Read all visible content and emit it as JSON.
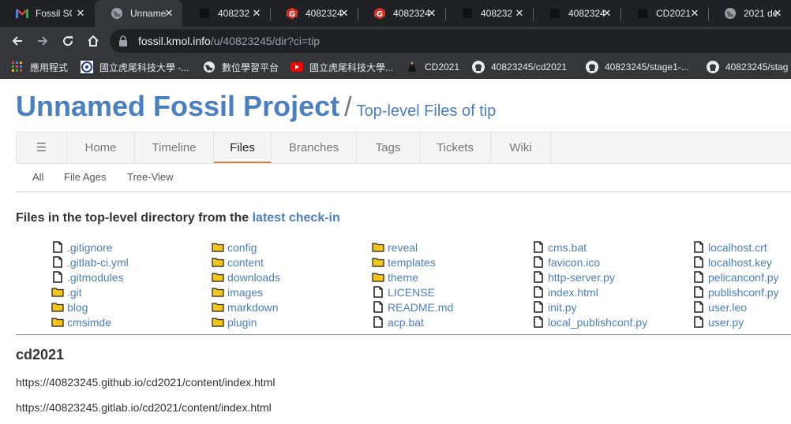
{
  "browser": {
    "tabs": [
      {
        "title": "Fossil SC",
        "icon": "gmail-icon",
        "active": false
      },
      {
        "title": "Unname",
        "icon": "globe-icon",
        "active": true
      },
      {
        "title": "408232",
        "icon": "dark-square-icon",
        "active": false
      },
      {
        "title": "4082324",
        "icon": "red-g-icon",
        "active": false
      },
      {
        "title": "4082324",
        "icon": "red-g-icon",
        "active": false
      },
      {
        "title": "408232",
        "icon": "dark-square-icon",
        "active": false
      },
      {
        "title": "4082324",
        "icon": "dark-square-icon",
        "active": false
      },
      {
        "title": "CD2021",
        "icon": "dark-square-icon",
        "active": false
      },
      {
        "title": "2021 de",
        "icon": "globe-icon",
        "active": false
      }
    ],
    "url_host": "fossil.kmol.info",
    "url_path": "/u/40823245/dir?ci=tip",
    "bookmarks": [
      {
        "label": "應用程式",
        "icon": "apps-grid-icon"
      },
      {
        "label": "國立虎尾科技大學 -...",
        "icon": "school-logo-icon"
      },
      {
        "label": "數位學習平台",
        "icon": "globe-icon"
      },
      {
        "label": "國立虎尾科技大學...",
        "icon": "youtube-icon"
      },
      {
        "label": "CD2021",
        "icon": "dark-logo-icon"
      },
      {
        "label": "40823245/cd2021",
        "icon": "github-icon"
      },
      {
        "label": "40823245/stage1-...",
        "icon": "github-icon"
      },
      {
        "label": "40823245/stag",
        "icon": "github-icon"
      }
    ]
  },
  "header": {
    "project_title": "Unnamed Fossil Project",
    "separator": "/",
    "subtitle": "Top-level Files of tip"
  },
  "mainmenu": {
    "hamburger": "☰",
    "items": [
      "Home",
      "Timeline",
      "Files",
      "Branches",
      "Tags",
      "Tickets",
      "Wiki"
    ],
    "active": "Files"
  },
  "submenu": {
    "items": [
      "All",
      "File Ages",
      "Tree-View"
    ]
  },
  "files": {
    "heading_prefix": "Files in the top-level directory from the ",
    "heading_link": "latest check-in",
    "columns": [
      [
        {
          "name": ".gitignore",
          "type": "file"
        },
        {
          "name": ".gitlab-ci.yml",
          "type": "file"
        },
        {
          "name": ".gitmodules",
          "type": "file"
        },
        {
          "name": ".git",
          "type": "folder"
        },
        {
          "name": "blog",
          "type": "folder"
        },
        {
          "name": "cmsimde",
          "type": "folder"
        }
      ],
      [
        {
          "name": "config",
          "type": "folder"
        },
        {
          "name": "content",
          "type": "folder"
        },
        {
          "name": "downloads",
          "type": "folder"
        },
        {
          "name": "images",
          "type": "folder"
        },
        {
          "name": "markdown",
          "type": "folder"
        },
        {
          "name": "plugin",
          "type": "folder"
        }
      ],
      [
        {
          "name": "reveal",
          "type": "folder"
        },
        {
          "name": "templates",
          "type": "folder"
        },
        {
          "name": "theme",
          "type": "folder"
        },
        {
          "name": "LICENSE",
          "type": "file"
        },
        {
          "name": "README.md",
          "type": "file"
        },
        {
          "name": "acp.bat",
          "type": "file"
        }
      ],
      [
        {
          "name": "cms.bat",
          "type": "file"
        },
        {
          "name": "favicon.ico",
          "type": "file"
        },
        {
          "name": "http-server.py",
          "type": "file"
        },
        {
          "name": "index.html",
          "type": "file"
        },
        {
          "name": "init.py",
          "type": "file"
        },
        {
          "name": "local_publishconf.py",
          "type": "file"
        }
      ],
      [
        {
          "name": "localhost.crt",
          "type": "file"
        },
        {
          "name": "localhost.key",
          "type": "file"
        },
        {
          "name": "pelicanconf.py",
          "type": "file"
        },
        {
          "name": "publishconf.py",
          "type": "file"
        },
        {
          "name": "user.leo",
          "type": "file"
        },
        {
          "name": "user.py",
          "type": "file"
        }
      ]
    ]
  },
  "readme": {
    "title": "cd2021",
    "lines": [
      "https://40823245.github.io/cd2021/content/index.html",
      "https://40823245.gitlab.io/cd2021/content/index.html"
    ]
  },
  "colors": {
    "link": "#4a7fc1",
    "folder": "#f5c518",
    "active_tab_underline": "#c7844a",
    "chrome_dark": "#202124",
    "chrome_toolbar": "#35363a"
  }
}
